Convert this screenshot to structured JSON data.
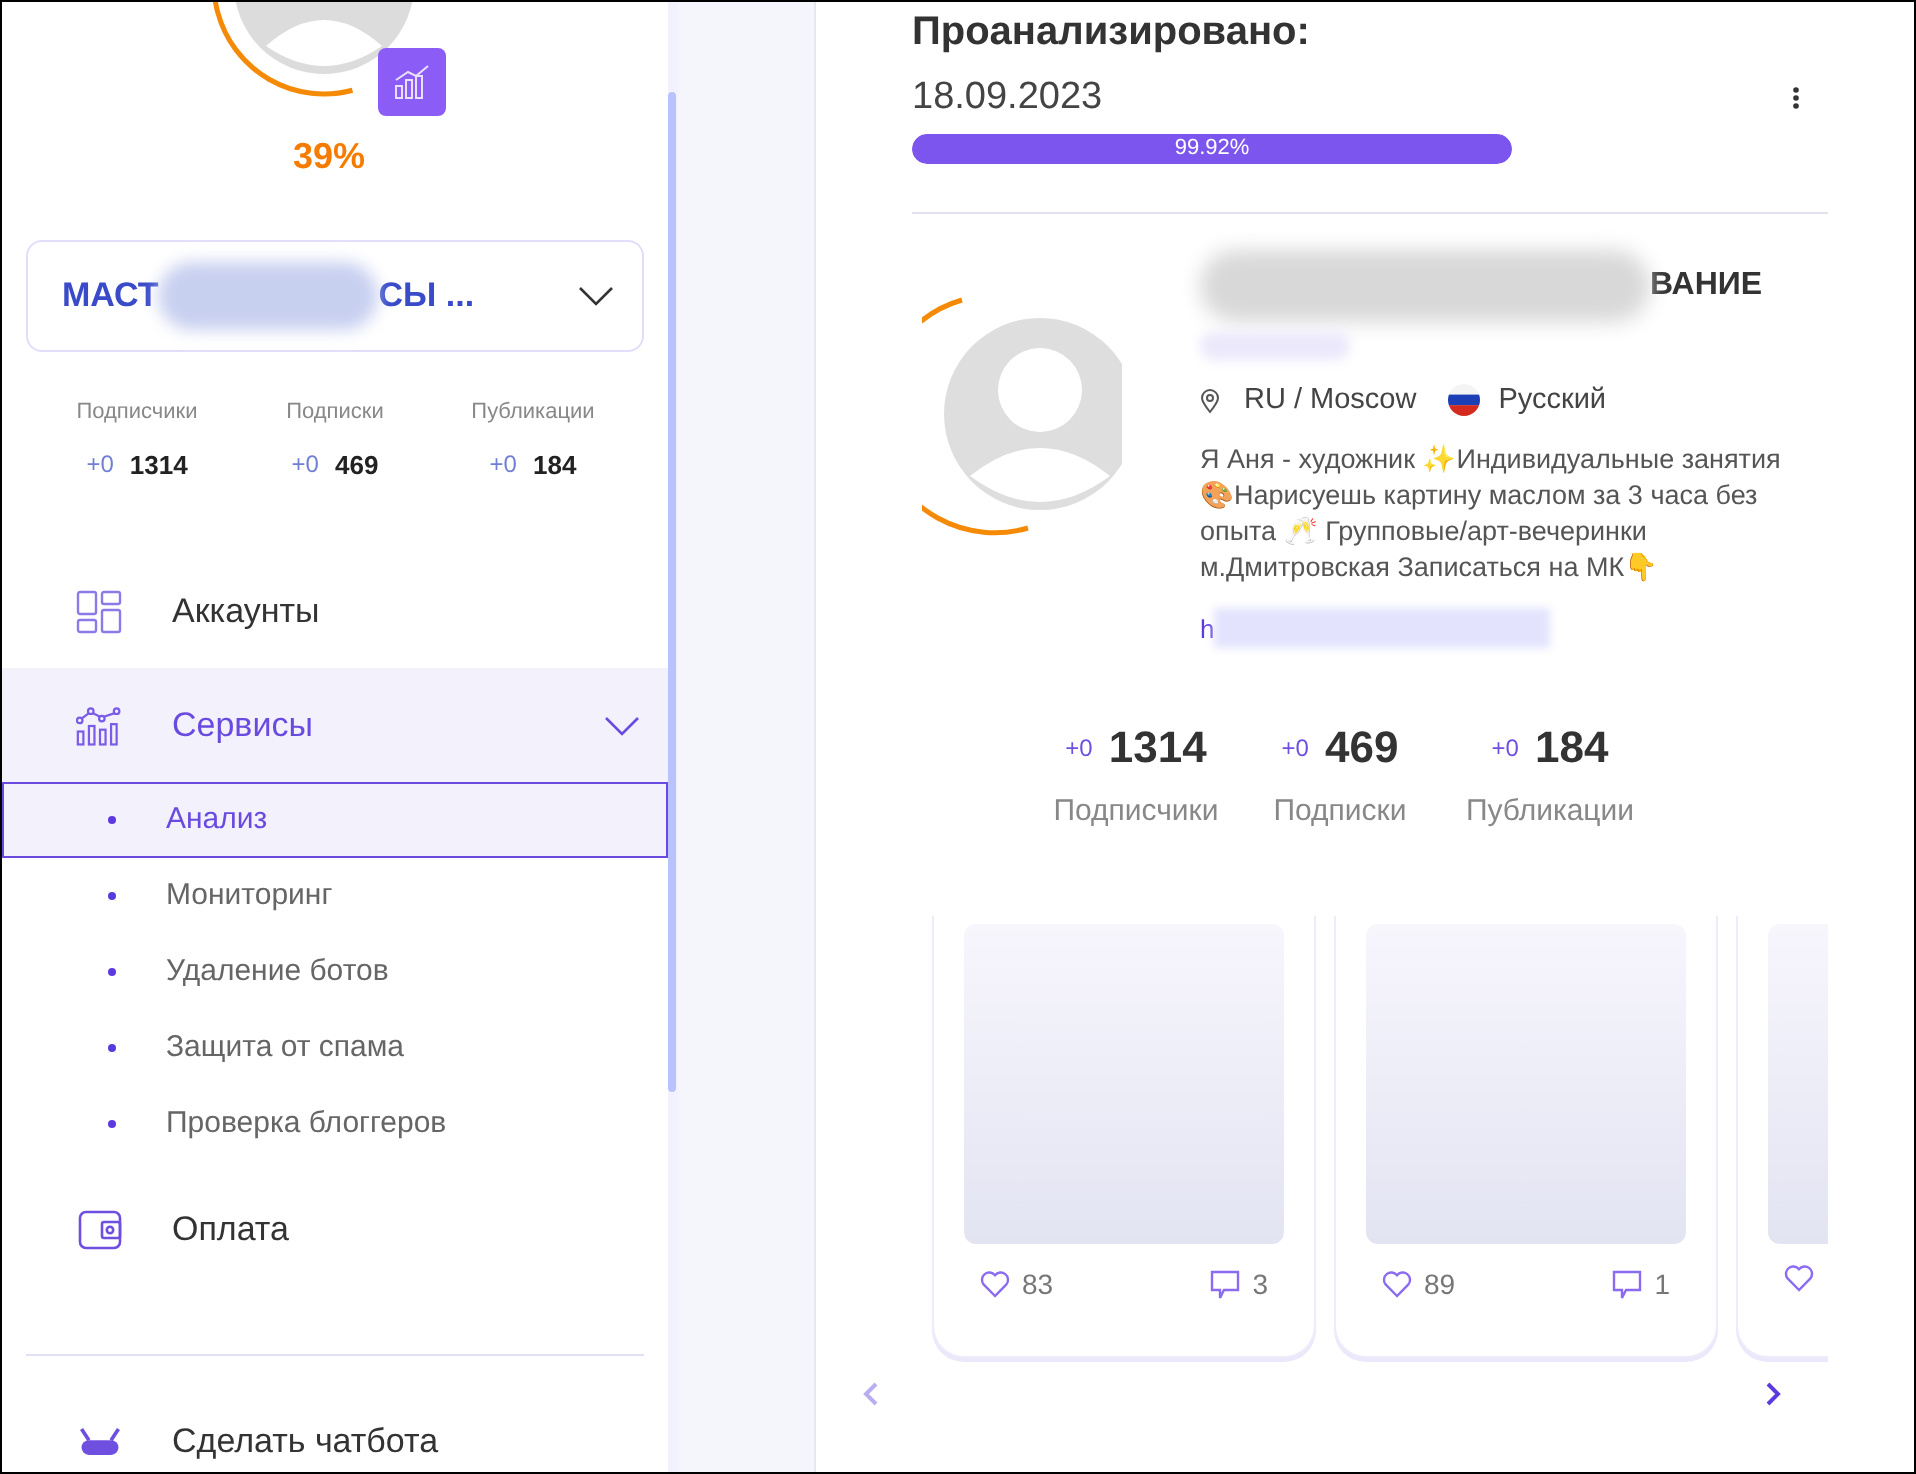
{
  "account_score": {
    "label": "39%"
  },
  "account_selector": {
    "name_start": "МАСТ",
    "name_end": "СЫ ...",
    "expanded": false
  },
  "account_stats": [
    {
      "label": "Подписчики",
      "delta": "+0",
      "value": "1314"
    },
    {
      "label": "Подписки",
      "delta": "+0",
      "value": "469"
    },
    {
      "label": "Публикации",
      "delta": "+0",
      "value": "184"
    }
  ],
  "nav": [
    {
      "label": "Аккаунты",
      "kind": "accounts",
      "selected": false
    },
    {
      "label": "Сервисы",
      "kind": "services",
      "selected": true,
      "expanded": true,
      "children": [
        {
          "label": "Анализ",
          "selected": true
        },
        {
          "label": "Мониторинг",
          "selected": false
        },
        {
          "label": "Удаление ботов",
          "selected": false
        },
        {
          "label": "Защита от спама",
          "selected": false
        },
        {
          "label": "Проверка блоггеров",
          "selected": false
        }
      ]
    },
    {
      "label": "Оплата",
      "kind": "payment",
      "selected": false
    },
    {
      "label": "Сделать чатбота",
      "kind": "bot",
      "selected": false
    }
  ],
  "analysis": {
    "title": "Проанализировано:",
    "date": "18.09.2023",
    "progress": {
      "level": 0.9992,
      "label": "99.92%"
    }
  },
  "profile": {
    "name_end": "ВАНИЕ",
    "location": "RU / Moscow",
    "language": "Русский",
    "bio": "Я Аня - художник ✨Индивидуальные занятия 🎨Нарисуешь картину маслом за 3 часа без опыта 🥂 Групповые/арт-вечеринки м.Дмитровская Записаться на МК👇",
    "link_start": "h",
    "stats": [
      {
        "label": "Подписчики",
        "delta": "+0",
        "value": "1314"
      },
      {
        "label": "Подписки",
        "delta": "+0",
        "value": "469"
      },
      {
        "label": "Публикации",
        "delta": "+0",
        "value": "184"
      }
    ]
  },
  "posts": [
    {
      "likes": "83",
      "comments": "3"
    },
    {
      "likes": "89",
      "comments": "1"
    }
  ]
}
